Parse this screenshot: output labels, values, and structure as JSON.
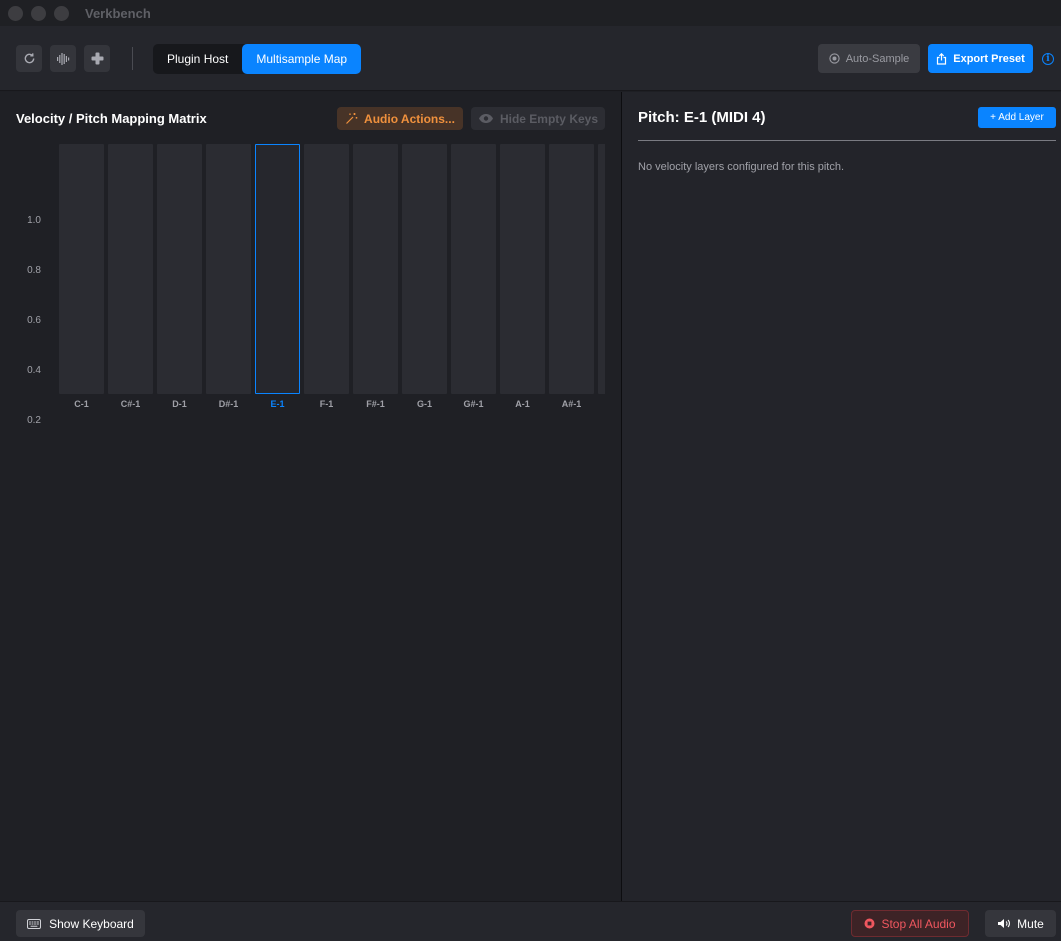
{
  "window": {
    "title": "Verkbench"
  },
  "toolbar": {
    "icons": [
      "refresh-icon",
      "waveform-icon",
      "plus-icon"
    ],
    "tabs": [
      {
        "label": "Plugin Host",
        "active": false
      },
      {
        "label": "Multisample Map",
        "active": true
      }
    ],
    "auto_sample_label": "Auto-Sample",
    "export_preset_label": "Export Preset",
    "info_glyph": "i"
  },
  "matrix": {
    "title": "Velocity / Pitch Mapping Matrix",
    "audio_actions_label": "Audio Actions...",
    "hide_empty_label": "Hide Empty Keys",
    "y_ticks": [
      "1.0",
      "0.8",
      "0.6",
      "0.4",
      "0.2"
    ],
    "keys": [
      "C-1",
      "C#-1",
      "D-1",
      "D#-1",
      "E-1",
      "F-1",
      "F#-1",
      "G-1",
      "G#-1",
      "A-1",
      "A#-1",
      ""
    ],
    "selected_key": "E-1"
  },
  "detail": {
    "title": "Pitch: E-1 (MIDI 4)",
    "add_layer_label": "+ Add Layer",
    "empty_message": "No velocity layers configured for this pitch."
  },
  "statusbar": {
    "show_keyboard_label": "Show Keyboard",
    "stop_audio_label": "Stop All Audio",
    "mute_label": "Mute"
  },
  "colors": {
    "accent": "#0a84ff",
    "warning": "#f0913d",
    "danger": "#f0575f"
  }
}
